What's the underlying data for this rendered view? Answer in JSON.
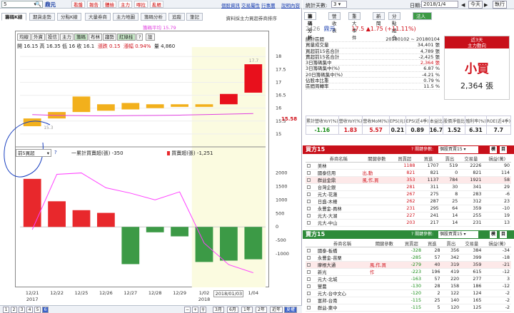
{
  "toolbar": {
    "symbol": "5",
    "stock_name": "鼎元",
    "buttons": [
      "看盤",
      "報告",
      "體檢",
      "主力",
      "啄拉",
      "亂帳"
    ],
    "links": [
      "個股資訊",
      "交易屬性",
      "行事曆",
      "說明內容"
    ]
  },
  "left_tabs": [
    "籌碼K線",
    "期貨走勢",
    "分點K線",
    "大量券商",
    "主力地圖",
    "籌碼分析",
    "追蹤",
    "筆記"
  ],
  "left_note": "資料採主力買超券商排序",
  "indicator_buttons": [
    "均線",
    "外資",
    "投信",
    "主力",
    "籌碼",
    "布林",
    "趨勢",
    "紅綠柱",
    "?",
    "設"
  ],
  "ohlc": {
    "open_label": "開",
    "open": "16.15",
    "high_label": "高",
    "high": "16.35",
    "low_label": "低",
    "low": "16",
    "close_label": "收",
    "close": "16.1",
    "chg_label": "漲跌",
    "chg": "0.15",
    "pct_label": "漲幅",
    "pct": "0.94%",
    "vol_label": "量",
    "vol": "4,860"
  },
  "price_legend": "籌碼平均 15.79",
  "price_markers": {
    "high_tag": "17.7",
    "low_tag": "15.3",
    "current": "15.58"
  },
  "chart_data": [
    {
      "type": "candlestick",
      "title": "",
      "categories": [
        "12/21",
        "12/22",
        "12/25",
        "12/26",
        "12/27",
        "12/28",
        "12/29",
        "1/02",
        "1/03",
        "1/04"
      ],
      "open": [
        15.3,
        15.6,
        15.85,
        15.9,
        15.95,
        16.0,
        16.05,
        16.05,
        16.15,
        16.6
      ],
      "close": [
        15.6,
        15.85,
        16.45,
        16.15,
        16.2,
        16.15,
        16.15,
        16.15,
        16.55,
        17.7
      ],
      "line": [
        15.75,
        15.72,
        15.71,
        15.7,
        15.71,
        15.72,
        15.73,
        15.75,
        15.77,
        15.79
      ],
      "ylim": [
        14.5,
        18.2
      ],
      "yticks": [
        15,
        15.5,
        16,
        16.5,
        17,
        17.5,
        18
      ],
      "colors": [
        "#f2b01c",
        "#f2b01c",
        "#f2b01c",
        "#f2b01c",
        "#f2b01c",
        "#f2b01c",
        "#f2b01c",
        "#f2b01c",
        "#e8101c",
        "#e8101c"
      ]
    },
    {
      "type": "bar",
      "title": "",
      "categories": [
        "12/21",
        "12/22",
        "12/25",
        "12/26",
        "12/27",
        "12/28",
        "12/29",
        "1/02",
        "1/03",
        "1/04"
      ],
      "series": [
        {
          "name": "買賣超(張)",
          "values": [
            1780,
            950,
            620,
            520,
            -1380,
            -200,
            -350,
            -1300,
            -1250,
            -1200
          ]
        },
        {
          "name": "累計買賣超(張)",
          "values": [
            -100,
            1950,
            2000,
            1450,
            1250,
            1000,
            1300,
            -600,
            -1400,
            -1700
          ]
        }
      ],
      "ylim": [
        -1500,
        2200
      ],
      "yticks": [
        2000,
        1500,
        1000,
        500,
        0,
        -500,
        -1000
      ],
      "colors": {
        "pos": "#e8282c",
        "neg": "#3c9a46",
        "line": "#ff40ff"
      }
    }
  ],
  "pane2": {
    "dropdown": "前5買超",
    "q": "?",
    "legend_a": "一累計買賣超(張) -350",
    "legend_b": "買賣超(張) -1,251"
  },
  "x_labels": [
    "12/21",
    "12/22",
    "12/25",
    "12/26",
    "12/27",
    "12/28",
    "12/29",
    "1/02",
    "2018/01/03",
    "1/04"
  ],
  "x_years": [
    "2017",
    "2018"
  ],
  "bottom": {
    "pages": [
      "1",
      "2",
      "3",
      "4",
      "5",
      "6"
    ],
    "range": [
      "3月",
      "6月",
      "1年",
      "2年",
      "近年",
      "夏權"
    ]
  },
  "right": {
    "title_label": "統計天數:",
    "days": "3",
    "date_label": "日期:",
    "date": "2018/1/4",
    "today": "今天",
    "refresh": "執行",
    "tabs": [
      "籌碼分析",
      "營收表",
      "重大事件",
      "新聞",
      "分點組合",
      "法人目標(17.2元)"
    ],
    "code": "2426",
    "name": "鼎元",
    "price": "17.5",
    "change": "▲1.75 (+11.11%)",
    "info": [
      {
        "k": "統計區間",
        "v": "20180102 ~ 20180104",
        "c": ""
      },
      {
        "k": "買量成交量",
        "v": "34,401 張",
        "c": ""
      },
      {
        "k": "買超前15名合計",
        "v": "4,789 張",
        "c": ""
      },
      {
        "k": "賣超前15名合計",
        "v": "-2,425 張",
        "c": ""
      },
      {
        "k": "3日籌碼集中",
        "v": "2,364 張",
        "c": "red"
      },
      {
        "k": "3日籌碼集中(%)",
        "v": "6.87 %",
        "c": ""
      },
      {
        "k": "20日籌碼集中(%)",
        "v": "-4.21 %",
        "c": ""
      },
      {
        "k": "佔股本比重",
        "v": "0.79 %",
        "c": ""
      },
      {
        "k": "區間周轉率",
        "v": "11.5 %",
        "c": ""
      }
    ],
    "panel": {
      "line1": "近3天",
      "line2": "主力動向",
      "verdict": "小買",
      "qty": "2,364 張"
    },
    "stats": {
      "heads": [
        "累計營收YoY(%)",
        "營收YoY(%)",
        "營收MoM(%)",
        "EPS(元)",
        "EPS(近4季)",
        "本益比",
        "股價淨值比",
        "殖利率(%)",
        "ROE(近4季)"
      ],
      "vals": [
        "-1.16",
        "1.83",
        "5.57",
        "0.21",
        "0.89",
        "16.7",
        "1.52",
        "6.31",
        "7.7"
      ]
    },
    "buy": {
      "title": "買方15",
      "filter": "個股買賣15",
      "q": "?",
      "filter_label": "關鍵參數:",
      "btn1": "模",
      "btn2": "目",
      "heads": [
        "券商名稱",
        "關鍵參數",
        "買賣超",
        "買進",
        "賣出",
        "交易量",
        "損益(萬)"
      ],
      "rows": [
        [
          "美林",
          "",
          "1188",
          "1707",
          "519",
          "2226",
          "90"
        ],
        [
          "國泰信用",
          "出,動",
          "821",
          "821",
          "0",
          "821",
          "114"
        ],
        [
          "群益金鼎",
          "風,作,買",
          "353",
          "1137",
          "784",
          "1921",
          "58"
        ],
        [
          "台灣企銀",
          "",
          "281",
          "311",
          "30",
          "341",
          "29"
        ],
        [
          "元大-花蓮",
          "",
          "267",
          "275",
          "8",
          "283",
          "-6"
        ],
        [
          "日盛-木柵",
          "",
          "262",
          "287",
          "25",
          "312",
          "23"
        ],
        [
          "永豐金-員林",
          "",
          "231",
          "295",
          "64",
          "359",
          "-10"
        ],
        [
          "元大-大湖",
          "",
          "227",
          "241",
          "14",
          "255",
          "19"
        ],
        [
          "元大-中山",
          "",
          "203",
          "217",
          "14",
          "231",
          "13"
        ]
      ]
    },
    "sell": {
      "title": "賣方15",
      "filter": "個股買賣15",
      "q": "?",
      "filter_label": "關鍵參數:",
      "btn1": "模",
      "btn2": "目",
      "heads": [
        "券商名稱",
        "關鍵參數",
        "買賣超",
        "買進",
        "賣出",
        "交易量",
        "損益(萬)"
      ],
      "rows": [
        [
          "國泰-板橋",
          "",
          "-328",
          "28",
          "356",
          "384",
          "-34"
        ],
        [
          "永豐金-苗栗",
          "",
          "-285",
          "57",
          "342",
          "399",
          "-18"
        ],
        [
          "摩根大通",
          "風,作,買",
          "-279",
          "40",
          "319",
          "359",
          "-21"
        ],
        [
          "新光",
          "作",
          "-223",
          "196",
          "419",
          "615",
          "-12"
        ],
        [
          "元大-北城",
          "",
          "-163",
          "57",
          "220",
          "277",
          "3"
        ],
        [
          "豐農",
          "",
          "-130",
          "28",
          "158",
          "186",
          "-12"
        ],
        [
          "元大-台中文心",
          "",
          "-120",
          "2",
          "122",
          "124",
          "-2"
        ],
        [
          "富邦-台南",
          "",
          "-115",
          "25",
          "140",
          "165",
          "-2"
        ],
        [
          "群益-東中",
          "",
          "-115",
          "5",
          "120",
          "125",
          "-2"
        ]
      ]
    }
  }
}
